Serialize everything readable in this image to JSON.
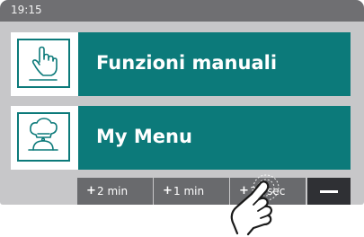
{
  "status_bar": {
    "time": "19:15"
  },
  "tiles": [
    {
      "label": "Funzioni manuali",
      "icon": "hand-pointer-icon"
    },
    {
      "label": "My Menu",
      "icon": "chef-hat-icon"
    }
  ],
  "time_buttons": [
    {
      "sign": "+",
      "label": "2 min"
    },
    {
      "sign": "+",
      "label": "1 min"
    },
    {
      "sign": "+",
      "label": "30 sec"
    }
  ],
  "minus_button": {
    "icon": "minus-icon"
  },
  "colors": {
    "accent": "#0c7a7a",
    "screen_background": "#c7c7c9",
    "status_bar": "#6f6f72",
    "button": "#696a6d",
    "minus_button": "#2f3034"
  }
}
